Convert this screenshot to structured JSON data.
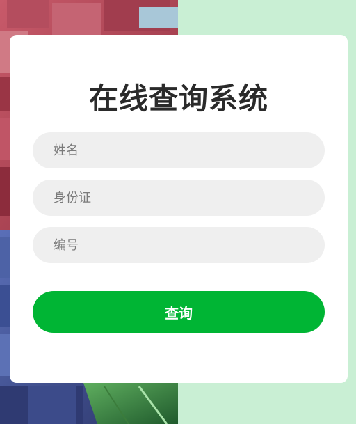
{
  "page": {
    "title": "在线查询系统"
  },
  "form": {
    "name_placeholder": "姓名",
    "id_placeholder": "身份证",
    "number_placeholder": "编号",
    "submit_label": "查询"
  },
  "colors": {
    "background_right": "#c9efd4",
    "card": "#ffffff",
    "field_bg": "#efefef",
    "button": "#00b534",
    "title_text": "#2a2a2a"
  }
}
